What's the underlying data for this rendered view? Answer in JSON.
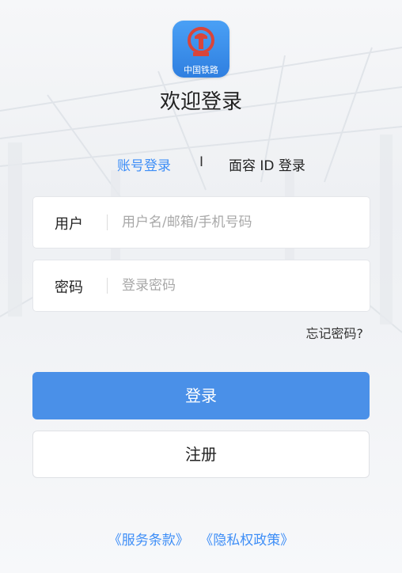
{
  "app": {
    "logo_icon": "china-railway-logo-icon",
    "logo_text": "中国铁路",
    "title": "欢迎登录"
  },
  "tabs": {
    "account_login": "账号登录",
    "separator": "I",
    "face_id_login": "面容 ID 登录"
  },
  "form": {
    "user_label": "用户",
    "user_placeholder": "用户名/邮箱/手机号码",
    "password_label": "密码",
    "password_placeholder": "登录密码",
    "forgot_password": "忘记密码?"
  },
  "buttons": {
    "login": "登录",
    "register": "注册"
  },
  "footer": {
    "terms": "《服务条款》",
    "privacy": "《隐私权政策》"
  },
  "colors": {
    "accent": "#3e8ef7",
    "login_button": "#4a90e8",
    "logo_background": "#3a8ff0",
    "logo_emblem": "#d9453a"
  }
}
